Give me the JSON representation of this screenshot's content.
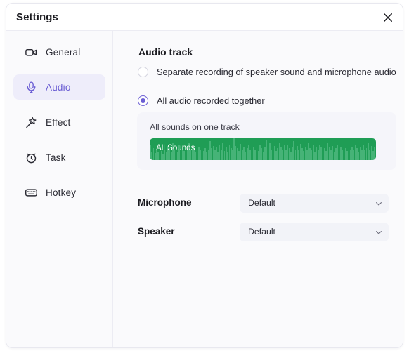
{
  "window": {
    "title": "Settings",
    "close_icon": "close-icon"
  },
  "sidebar": {
    "items": [
      {
        "label": "General",
        "icon": "video-camera-icon",
        "active": false
      },
      {
        "label": "Audio",
        "icon": "microphone-icon",
        "active": true
      },
      {
        "label": "Effect",
        "icon": "magic-wand-icon",
        "active": false
      },
      {
        "label": "Task",
        "icon": "alarm-clock-icon",
        "active": false
      },
      {
        "label": "Hotkey",
        "icon": "keyboard-icon",
        "active": false
      }
    ]
  },
  "main": {
    "section_title": "Audio track",
    "radios": [
      {
        "label": "Separate recording of speaker sound and microphone audio",
        "selected": false
      },
      {
        "label": "All audio recorded together",
        "selected": true
      }
    ],
    "waveform_card": {
      "caption": "All sounds on one track",
      "track_label": "All Sounds",
      "track_color": "#1f9d55",
      "wave_color": "#46b377",
      "levels": [
        38,
        22,
        30,
        18,
        26,
        20,
        34,
        24,
        16,
        28,
        22,
        36,
        30,
        20,
        44,
        26,
        32,
        22,
        40,
        28,
        34,
        24,
        18,
        30,
        46,
        26,
        36,
        30,
        22,
        54,
        34,
        28,
        42,
        24,
        30,
        20,
        26,
        48,
        30,
        36,
        26,
        32,
        22,
        38,
        28,
        44,
        24,
        34,
        20,
        40,
        30,
        26,
        56,
        36,
        30,
        24,
        42,
        28,
        34,
        22,
        30,
        38,
        26,
        46,
        32,
        28,
        36,
        24,
        40,
        30,
        22,
        34,
        52,
        28,
        44,
        26,
        32,
        36,
        24,
        30,
        46,
        34,
        28,
        40,
        26,
        38,
        30,
        22,
        34,
        48,
        28,
        36,
        26,
        42,
        30,
        24,
        34,
        28,
        44,
        30,
        26,
        38,
        22,
        32,
        28,
        40,
        34,
        26,
        30,
        24,
        46,
        32,
        28,
        36,
        22,
        30,
        38,
        26,
        34,
        28,
        42,
        30,
        24,
        36,
        28,
        32,
        26,
        40,
        30,
        22,
        34,
        28,
        38,
        26,
        30,
        44,
        28,
        36,
        24,
        32
      ]
    },
    "fields": [
      {
        "label": "Microphone",
        "value": "Default",
        "caret_icon": "chevron-down-icon"
      },
      {
        "label": "Speaker",
        "value": "Default",
        "caret_icon": "chevron-down-icon"
      }
    ]
  },
  "colors": {
    "accent": "#6c5fd4",
    "accent_bg": "#eeedfa",
    "track_green": "#1f9d55",
    "wave_green": "#46b377",
    "panel_bg": "#fafafc",
    "card_bg": "#f5f5fa",
    "select_bg": "#f2f3f8"
  }
}
